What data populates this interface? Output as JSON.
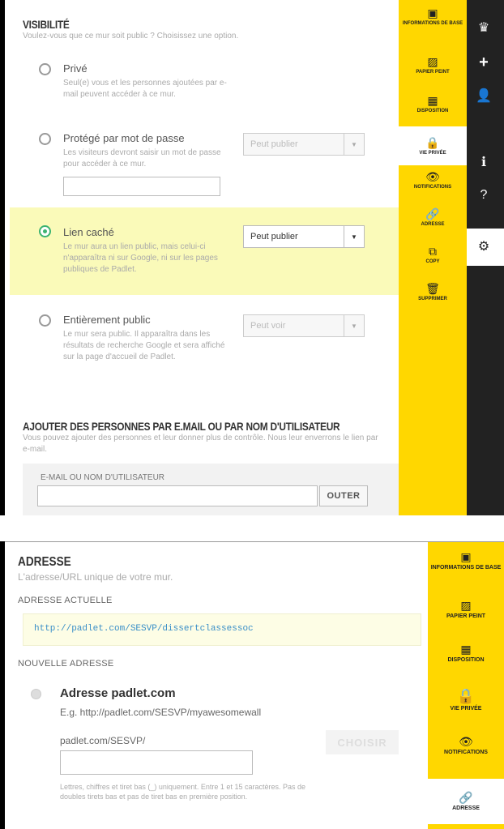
{
  "panel1": {
    "visibility": {
      "title": "VISIBILITÉ",
      "subtitle": "Voulez-vous que ce mur soit public ? Choisissez une option.",
      "options": [
        {
          "label": "Privé",
          "desc": "Seul(e) vous et les personnes ajoutées par e-mail peuvent accéder à ce mur."
        },
        {
          "label": "Protégé par mot de passe",
          "desc": "Les visiteurs devront saisir un mot de passe pour accéder à ce mur.",
          "select": "Peut publier"
        },
        {
          "label": "Lien caché",
          "desc": "Le mur aura un lien public, mais celui-ci n'apparaîtra ni sur Google, ni sur les pages publiques de Padlet.",
          "select": "Peut publier"
        },
        {
          "label": "Entièrement public",
          "desc": "Le mur sera public. Il apparaîtra dans les résultats de recherche Google et sera affiché sur la page d'accueil de Padlet.",
          "select": "Peut voir"
        }
      ]
    },
    "add_people": {
      "title": "AJOUTER DES PERSONNES PAR E.MAIL OU PAR NOM D'UTILISATEUR",
      "desc": "Vous pouvez ajouter des personnes et leur donner plus de contrôle. Nous leur enverrons le lien par e-mail.",
      "field_label": "E-MAIL OU NOM D'UTILISATEUR",
      "button": "OUTER"
    },
    "sidebar": [
      {
        "icon": "▣",
        "label": "INFORMATIONS DE BASE"
      },
      {
        "icon": "▨",
        "label": "PAPIER PEINT"
      },
      {
        "icon": "▦",
        "label": "DISPOSITION"
      },
      {
        "icon": "🔒",
        "label": "VIE PRIVÉE"
      },
      {
        "icon": "👁",
        "label": "NOTIFICATIONS"
      },
      {
        "icon": "🔗",
        "label": "ADRESSE"
      },
      {
        "icon": "⧉",
        "label": "COPY"
      },
      {
        "icon": "🗑",
        "label": "SUPPRIMER"
      }
    ],
    "darkbar": [
      "♛",
      "+",
      "👤",
      "ℹ",
      "?",
      "⚙"
    ]
  },
  "panel2": {
    "title": "ADRESSE",
    "subtitle": "L'adresse/URL unique de votre mur.",
    "current_label": "ADRESSE ACTUELLE",
    "current_url": "http://padlet.com/SESVP/dissertclassessoc",
    "new_label": "NOUVELLE ADRESSE",
    "option_title": "Adresse padlet.com",
    "option_example": "E.g. http://padlet.com/SESVP/myawesomewall",
    "prefix": "padlet.com/SESVP/",
    "choose_button": "CHOISIR",
    "rules": "Lettres, chiffres et tiret bas (_) uniquement. Entre 1 et 15 caractères. Pas de doubles tirets bas et pas de tiret bas en première position.",
    "sidebar": [
      {
        "icon": "▣",
        "label": "INFORMATIONS DE BASE"
      },
      {
        "icon": "▨",
        "label": "PAPIER PEINT"
      },
      {
        "icon": "▦",
        "label": "DISPOSITION"
      },
      {
        "icon": "🔒",
        "label": "VIE PRIVÉE"
      },
      {
        "icon": "👁",
        "label": "NOTIFICATIONS"
      },
      {
        "icon": "🔗",
        "label": "ADRESSE"
      }
    ]
  }
}
